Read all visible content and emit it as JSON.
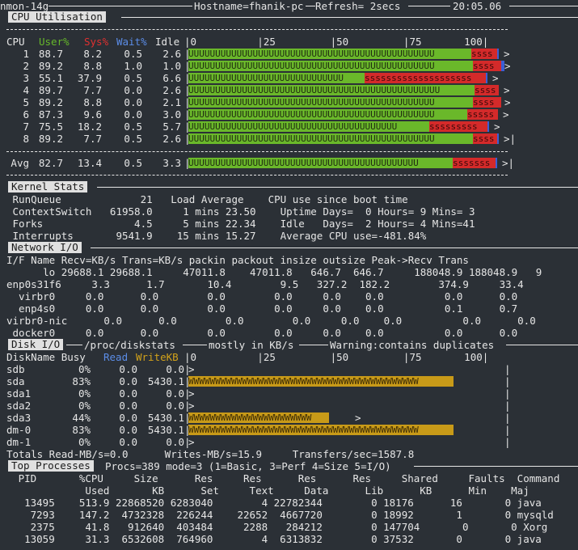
{
  "header": {
    "prog": "nmon-14g",
    "hostname": "Hostname=fhanik-pc",
    "refresh": "Refresh= 2secs",
    "time": "20:05.06"
  },
  "cpu": {
    "section_title": "CPU Utilisation",
    "col_cpu": "CPU",
    "col_user": "User%",
    "col_sys": "Sys%",
    "col_wait": "Wait%",
    "col_idle": "Idle",
    "scale": "|0          |25         |50         |75       100|",
    "rows": [
      {
        "cpu": "1",
        "user": "88.7",
        "sys": "8.2",
        "wait": "0.5",
        "idle": "2.6",
        "end": ">"
      },
      {
        "cpu": "2",
        "user": "89.2",
        "sys": "8.8",
        "wait": "1.0",
        "idle": "1.0",
        "end": ">"
      },
      {
        "cpu": "3",
        "user": "55.1",
        "sys": "37.9",
        "wait": "0.5",
        "idle": "6.6",
        "end": ">"
      },
      {
        "cpu": "4",
        "user": "89.7",
        "sys": "7.7",
        "wait": "0.0",
        "idle": "2.6",
        "end": ">"
      },
      {
        "cpu": "5",
        "user": "89.2",
        "sys": "8.8",
        "wait": "0.0",
        "idle": "2.1",
        "end": ">"
      },
      {
        "cpu": "6",
        "user": "87.3",
        "sys": "9.6",
        "wait": "0.0",
        "idle": "3.0",
        "end": ">"
      },
      {
        "cpu": "7",
        "user": "75.5",
        "sys": "18.2",
        "wait": "0.5",
        "idle": "5.7",
        "end": ">"
      },
      {
        "cpu": "8",
        "user": "89.2",
        "sys": "7.7",
        "wait": "0.5",
        "idle": "2.6",
        "end": ">|"
      }
    ],
    "avg": {
      "cpu": "Avg",
      "user": "82.7",
      "sys": "13.4",
      "wait": "0.5",
      "idle": "3.3",
      "end": ">|"
    }
  },
  "kernel": {
    "section_title": "Kernel Stats",
    "lines": [
      " RunQueue             21   Load Average    CPU use since boot time",
      " ContextSwitch   61958.0     1 mins 23.50    Uptime Days=  0 Hours= 9 Mins= 3",
      " Forks               4.5     5 mins 22.34    Idle   Days=  2 Hours= 4 Mins=41",
      " Interrupts       9541.9    15 mins 15.27    Average CPU use=-481.84%"
    ]
  },
  "network": {
    "section_title": "Network I/O",
    "header": "I/F Name Recv=KB/s Trans=KB/s packin packout insize outsize Peak->Recv Trans",
    "lines": [
      "      lo 29688.1 29688.1     47011.8    47011.8   646.7  646.7     188048.9 188048.9   9",
      "enp0s31f6     3.3      1.7       10.4        9.5   327.2  182.2        374.9     33.4",
      "  virbr0     0.0      0.0        0.0        0.0     0.0    0.0          0.0      0.0",
      "  enp4s0     0.0      0.0        0.0        0.0     0.0    0.0          0.1      0.7",
      "virbr0-nic      0.0      0.0        0.0        0.0     0.0    0.0          0.0      0.0",
      " docker0     0.0      0.0        0.0        0.0     0.0    0.0          0.0      0.0"
    ]
  },
  "disk": {
    "section_title": "Disk I/O",
    "path": "/proc/diskstats",
    "units": "mostly in KB/s",
    "warning": "Warning:contains duplicates",
    "col_name": "DiskName Busy",
    "col_read": "Read",
    "col_write": "WriteKB",
    "scale": "|0          |25         |50         |75       100|",
    "rows": [
      {
        "name": "sdb",
        "busy": "0%",
        "read": "0.0",
        "write": "0.0",
        "tail": "|>",
        "busy_frac": 0
      },
      {
        "name": "sda",
        "busy": "83%",
        "read": "0.0",
        "write": "5430.1",
        "tail": "|",
        "busy_frac": 0.83
      },
      {
        "name": "sda1",
        "busy": "0%",
        "read": "0.0",
        "write": "0.0",
        "tail": "|>",
        "busy_frac": 0
      },
      {
        "name": "sda2",
        "busy": "0%",
        "read": "0.0",
        "write": "0.0",
        "tail": "|>",
        "busy_frac": 0
      },
      {
        "name": "sda3",
        "busy": "44%",
        "read": "0.0",
        "write": "5430.1",
        "tail": "|",
        "busy_frac": 0.44
      },
      {
        "name": "dm-0",
        "busy": "83%",
        "read": "0.0",
        "write": "5430.1",
        "tail": "|",
        "busy_frac": 0.83
      },
      {
        "name": "dm-1",
        "busy": "0%",
        "read": "0.0",
        "write": "0.0",
        "tail": "|>",
        "busy_frac": 0
      }
    ],
    "totals": "Totals Read-MB/s=0.0      Writes-MB/s=15.9     Transfers/sec=1587.8"
  },
  "top": {
    "section_title": "Top Processes",
    "summary": "Procs=389 mode=3 (1=Basic, 3=Perf 4=Size 5=I/O)",
    "header1": "   PID       %CPU     Size      Res     Res      Res      Res     Shared     Faults  Command",
    "header2": "              Used       KB      Set     Text     Data      Lib      KB      Min    Maj",
    "lines": [
      "    13495    513.9 22868520 6283040        4 22782344        0 18176      16       0 java",
      "     7293    147.2  4732328  226244    22652  4667720        0 18992       1       0 mysqld",
      "     2375     41.8   912640  403484     2288   284212        0 147704       0       0 Xorg",
      "    13059     31.3  6532608  764960        4  6313832        0 37532       0       0 java"
    ]
  }
}
